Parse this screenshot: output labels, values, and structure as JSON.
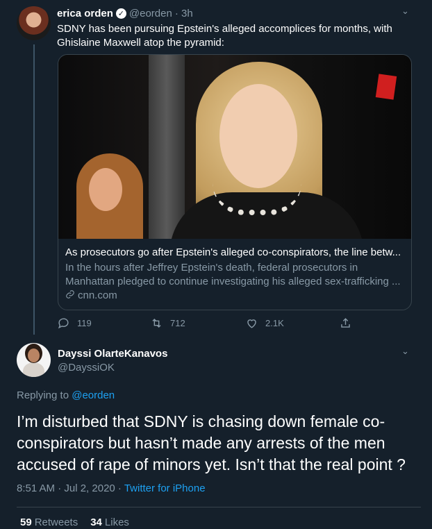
{
  "tweet1": {
    "name": "erica orden",
    "handle": "@eorden",
    "time": "· 3h",
    "text": "SDNY has been pursuing Epstein's alleged accomplices for months, with Ghislaine Maxwell atop the pyramid:",
    "card": {
      "title": "As prosecutors go after Epstein's alleged co-conspirators, the line betw...",
      "description": "In the hours after Jeffrey Epstein's death, federal prosecutors in Manhattan pledged to continue investigating his alleged sex-trafficking ...",
      "domain": "cnn.com"
    },
    "actions": {
      "replies": "119",
      "retweets": "712",
      "likes": "2.1K"
    }
  },
  "tweet2": {
    "name": "Dayssi OlarteKanavos",
    "handle": "@DayssiOK",
    "replying_prefix": "Replying to",
    "replying_to": "@eorden",
    "text": "I’m disturbed that SDNY is chasing down female co-conspirators but hasn’t made any arrests of the men accused of rape of minors yet.  Isn’t that the real point ?",
    "timestamp": "8:51 AM · Jul 2, 2020 ·",
    "source": "Twitter for iPhone",
    "retweets_count": "59",
    "retweets_label": "Retweets",
    "likes_count": "34",
    "likes_label": "Likes"
  },
  "icons": {
    "verified": "✓",
    "chevron": "⌄",
    "link": "🔗"
  },
  "colors": {
    "background": "#15202b",
    "accent": "#1da1f2",
    "muted": "#8899a6",
    "border": "#38444d"
  }
}
